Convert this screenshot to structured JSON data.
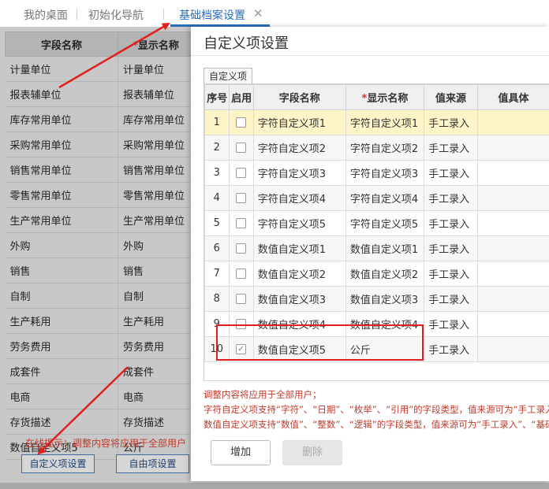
{
  "tabs": [
    {
      "label": "我的桌面"
    },
    {
      "label": "初始化导航"
    },
    {
      "label": "基础档案设置",
      "active": true
    }
  ],
  "background_table": {
    "headers": [
      "字段名称",
      "显示名称"
    ],
    "required_mark": "*",
    "rows": [
      [
        "计量单位",
        "计量单位"
      ],
      [
        "报表辅单位",
        "报表辅单位"
      ],
      [
        "库存常用单位",
        "库存常用单位"
      ],
      [
        "采购常用单位",
        "采购常用单位"
      ],
      [
        "销售常用单位",
        "销售常用单位"
      ],
      [
        "零售常用单位",
        "零售常用单位"
      ],
      [
        "生产常用单位",
        "生产常用单位"
      ],
      [
        "外购",
        "外购"
      ],
      [
        "销售",
        "销售"
      ],
      [
        "自制",
        "自制"
      ],
      [
        "生产耗用",
        "生产耗用"
      ],
      [
        "劳务费用",
        "劳务费用"
      ],
      [
        "成套件",
        "成套件"
      ],
      [
        "电商",
        "电商"
      ],
      [
        "存货描述",
        "存货描述"
      ],
      [
        "数值自定义项5",
        "公斤"
      ]
    ],
    "hint": "在线提示：调整内容将应用于全部用户",
    "buttons": {
      "custom": "自定义项设置",
      "free": "自由项设置"
    }
  },
  "modal": {
    "title": "自定义项设置",
    "inner_tab": "自定义项",
    "columns": [
      "序号",
      "启用",
      "字段名称",
      "显示名称",
      "值来源",
      "值具体"
    ],
    "required_mark": "*",
    "rows": [
      {
        "no": "1",
        "enabled": false,
        "field": "字符自定义项1",
        "display": "字符自定义项1",
        "source": "手工录入"
      },
      {
        "no": "2",
        "enabled": false,
        "field": "字符自定义项2",
        "display": "字符自定义项2",
        "source": "手工录入"
      },
      {
        "no": "3",
        "enabled": false,
        "field": "字符自定义项3",
        "display": "字符自定义项3",
        "source": "手工录入"
      },
      {
        "no": "4",
        "enabled": false,
        "field": "字符自定义项4",
        "display": "字符自定义项4",
        "source": "手工录入"
      },
      {
        "no": "5",
        "enabled": false,
        "field": "字符自定义项5",
        "display": "字符自定义项5",
        "source": "手工录入"
      },
      {
        "no": "6",
        "enabled": false,
        "field": "数值自定义项1",
        "display": "数值自定义项1",
        "source": "手工录入"
      },
      {
        "no": "7",
        "enabled": false,
        "field": "数值自定义项2",
        "display": "数值自定义项2",
        "source": "手工录入"
      },
      {
        "no": "8",
        "enabled": false,
        "field": "数值自定义项3",
        "display": "数值自定义项3",
        "source": "手工录入"
      },
      {
        "no": "9",
        "enabled": false,
        "field": "数值自定义项4",
        "display": "数值自定义项4",
        "source": "手工录入"
      },
      {
        "no": "10",
        "enabled": true,
        "field": "数值自定义项5",
        "display": "公斤",
        "source": "手工录入"
      }
    ],
    "notes": [
      "调整内容将应用于全部用户；",
      "字符自定义项支持“字符”、“日期”、“枚举”、“引用”的字段类型，值来源可为“手工录入”",
      "数值自定义项支持“数值”、“整数”、“逻辑”的字段类型，值来源可为“手工录入”、“基础"
    ],
    "buttons": {
      "add": "增加",
      "delete": "删除"
    }
  },
  "colors": {
    "accent": "#2a6ebb",
    "annotation": "#e02020",
    "note_text": "#c0392b",
    "selected_row": "#fdf5c8"
  }
}
